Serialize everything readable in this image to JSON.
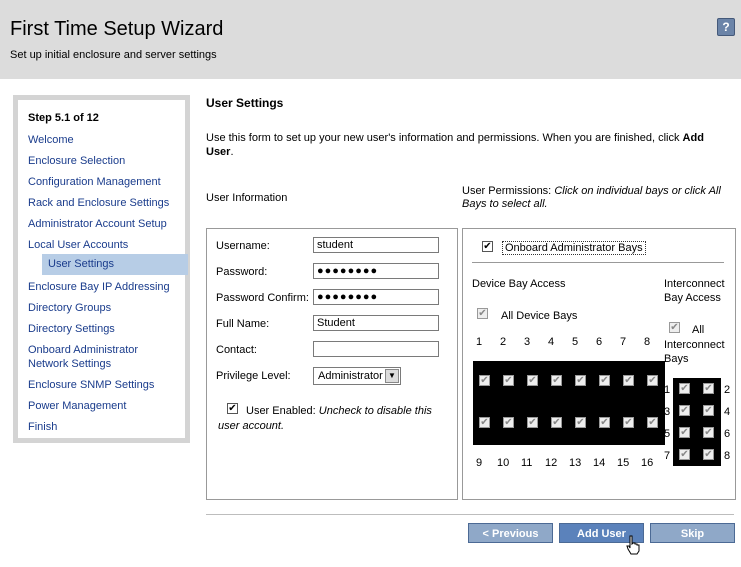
{
  "header": {
    "title": "First Time Setup Wizard",
    "subtitle": "Set up initial enclosure and server settings",
    "help_label": "?"
  },
  "sidebar": {
    "step": "Step 5.1 of 12",
    "items": [
      "Welcome",
      "Enclosure Selection",
      "Configuration Management",
      "Rack and Enclosure Settings",
      "Administrator Account Setup",
      "Local User Accounts",
      "User Settings",
      "Enclosure Bay IP Addressing",
      "Directory Groups",
      "Directory Settings",
      "Onboard Administrator",
      "Network Settings",
      "Enclosure SNMP Settings",
      "Power Management",
      "Finish"
    ]
  },
  "main": {
    "title": "User Settings",
    "intro_text": "Use this form to set up your new user's information and permissions. When you are finished, click ",
    "intro_bold": "Add User",
    "intro_end": ".",
    "user_info_label": "User Information",
    "perm_label": "User Permissions:",
    "perm_hint": "Click on individual bays or click All Bays to select all."
  },
  "form": {
    "username_label": "Username:",
    "username_value": "student",
    "password_label": "Password:",
    "password_value": "●●●●●●●●",
    "password_confirm_label": "Password Confirm:",
    "password_confirm_value": "●●●●●●●●",
    "fullname_label": "Full Name:",
    "fullname_value": "Student",
    "contact_label": "Contact:",
    "contact_value": "",
    "privilege_label": "Privilege Level:",
    "privilege_value": "Administrator",
    "user_enabled_label": "User Enabled:",
    "user_enabled_hint": "Uncheck to disable this user account.",
    "check_mark": "✔"
  },
  "permissions": {
    "oab_label": "Onboard Administrator Bays",
    "device_bay_access": "Device Bay Access",
    "interconnect_bay_access_1": "Interconnect",
    "interconnect_bay_access_2": "Bay Access",
    "all_device_bays": "All Device Bays",
    "all_interconnect_1": "All",
    "all_interconnect_2": "Interconnect",
    "all_interconnect_3": "Bays",
    "top_numbers": [
      "1",
      "2",
      "3",
      "4",
      "5",
      "6",
      "7",
      "8"
    ],
    "bottom_numbers": [
      "9",
      "10",
      "11",
      "12",
      "13",
      "14",
      "15",
      "16"
    ],
    "ic_left": [
      "1",
      "3",
      "5",
      "7"
    ],
    "ic_right": [
      "2",
      "4",
      "6",
      "8"
    ]
  },
  "buttons": {
    "previous": "< Previous",
    "add_user": "Add User",
    "skip": "Skip"
  },
  "colors": {
    "header_bg": "#dcdcdc",
    "link": "#1a3c8c",
    "active_bg": "#b7cde6",
    "button": "#7f9dc4"
  }
}
